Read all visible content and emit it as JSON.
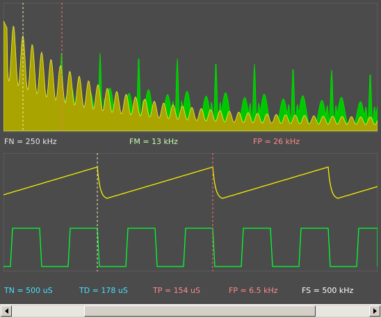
{
  "spectrum_labels": {
    "fn": {
      "text": "FN = 250 kHz",
      "color": "#e8e8e8"
    },
    "fm": {
      "text": "FM = 13 kHz",
      "color": "#c8ffb0"
    },
    "fp": {
      "text": "FP = 26 kHz",
      "color": "#ff8a8a"
    }
  },
  "time_labels": {
    "tn": {
      "text": "TN = 500 uS",
      "color": "#48e0ff"
    },
    "td": {
      "text": "TD = 178 uS",
      "color": "#48e0ff"
    },
    "tp": {
      "text": "TP = 154 uS",
      "color": "#ff8a8a"
    },
    "fp": {
      "text": "FP = 6.5 kHz",
      "color": "#ff8a8a"
    },
    "fs": {
      "text": "FS = 500 kHz",
      "color": "#ffffff"
    }
  },
  "colors": {
    "plot_bg": "#4b4b4b",
    "grid_frame": "#6a6a6a",
    "spectrum_yellow": "#a9a400",
    "spectrum_yellow_line": "#f0ee40",
    "spectrum_green": "#00c800",
    "sawtooth": "#f5f000",
    "square": "#00ff30",
    "marker_white": "#f0f0c0",
    "marker_red": "#ff7070"
  },
  "scrollbar": {
    "left_arrow": "scroll-left",
    "right_arrow": "scroll-right",
    "position": 0.2
  }
}
